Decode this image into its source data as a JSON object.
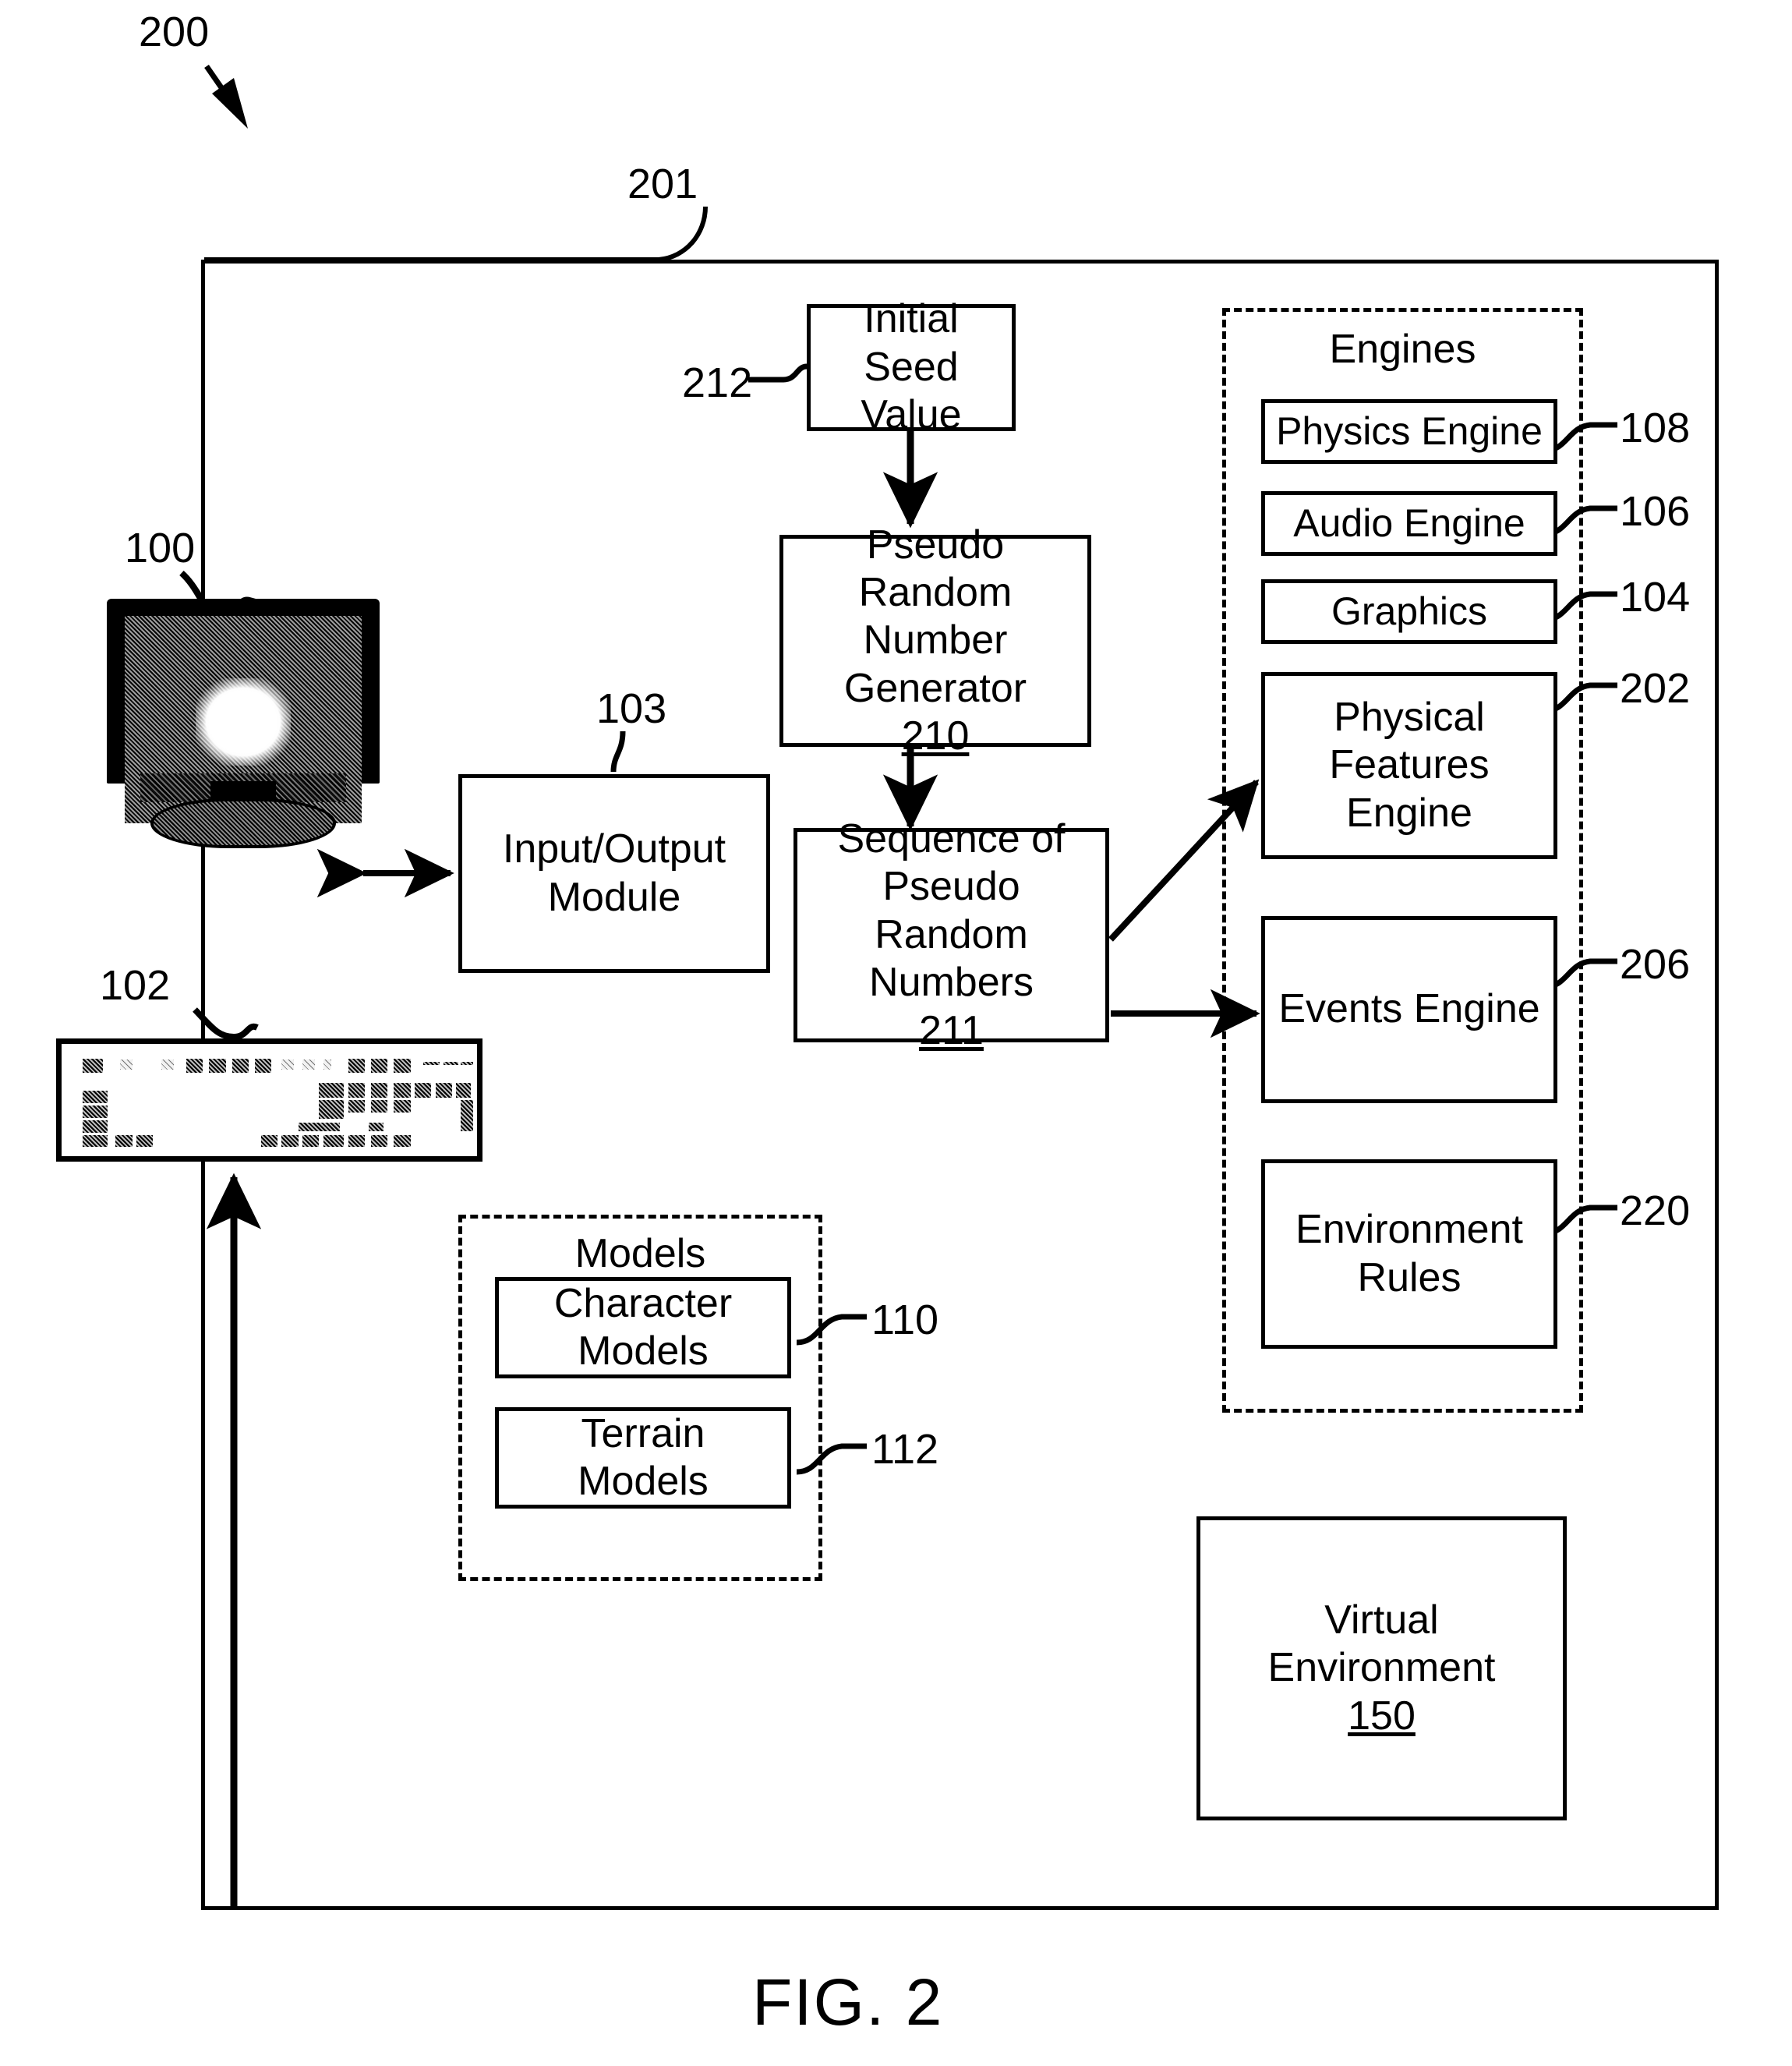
{
  "figure": {
    "caption": "FIG. 2",
    "system_label": "200",
    "system_boundary_label": "201"
  },
  "devices": {
    "monitor": {
      "label": "100",
      "name": "display-monitor"
    },
    "keyboard": {
      "label": "102",
      "name": "keyboard"
    }
  },
  "blocks": {
    "io_module": {
      "title": "Input/Output\nModule",
      "line1": "Input/Output",
      "line2": "Module",
      "label": "103"
    },
    "initial_seed": {
      "line1": "Initial Seed",
      "line2": "Value",
      "label": "212"
    },
    "prng": {
      "line1": "Pseudo Random",
      "line2": "Number",
      "line3": "Generator",
      "ref": "210"
    },
    "sequence": {
      "line1": "Sequence of",
      "line2": "Pseudo Random",
      "line3": "Numbers",
      "ref": "211"
    },
    "virtual_environment": {
      "line1": "Virtual Environment",
      "ref": "150"
    }
  },
  "engines_group": {
    "title": "Engines",
    "items": [
      {
        "label": "Physics Engine",
        "ref": "108"
      },
      {
        "label": "Audio Engine",
        "ref": "106"
      },
      {
        "label": "Graphics",
        "ref": "104"
      },
      {
        "label": "Physical\nFeatures\nEngine",
        "line1": "Physical",
        "line2": "Features",
        "line3": "Engine",
        "ref": "202"
      },
      {
        "label": "Events Engine",
        "ref": "206"
      },
      {
        "label": "Environment\nRules",
        "line1": "Environment",
        "line2": "Rules",
        "ref": "220"
      }
    ]
  },
  "models_group": {
    "title": "Models",
    "items": [
      {
        "line1": "Character",
        "line2": "Models",
        "ref": "110"
      },
      {
        "line1": "Terrain",
        "line2": "Models",
        "ref": "112"
      }
    ]
  },
  "colors": {
    "ink": "#000000",
    "paper": "#ffffff"
  }
}
